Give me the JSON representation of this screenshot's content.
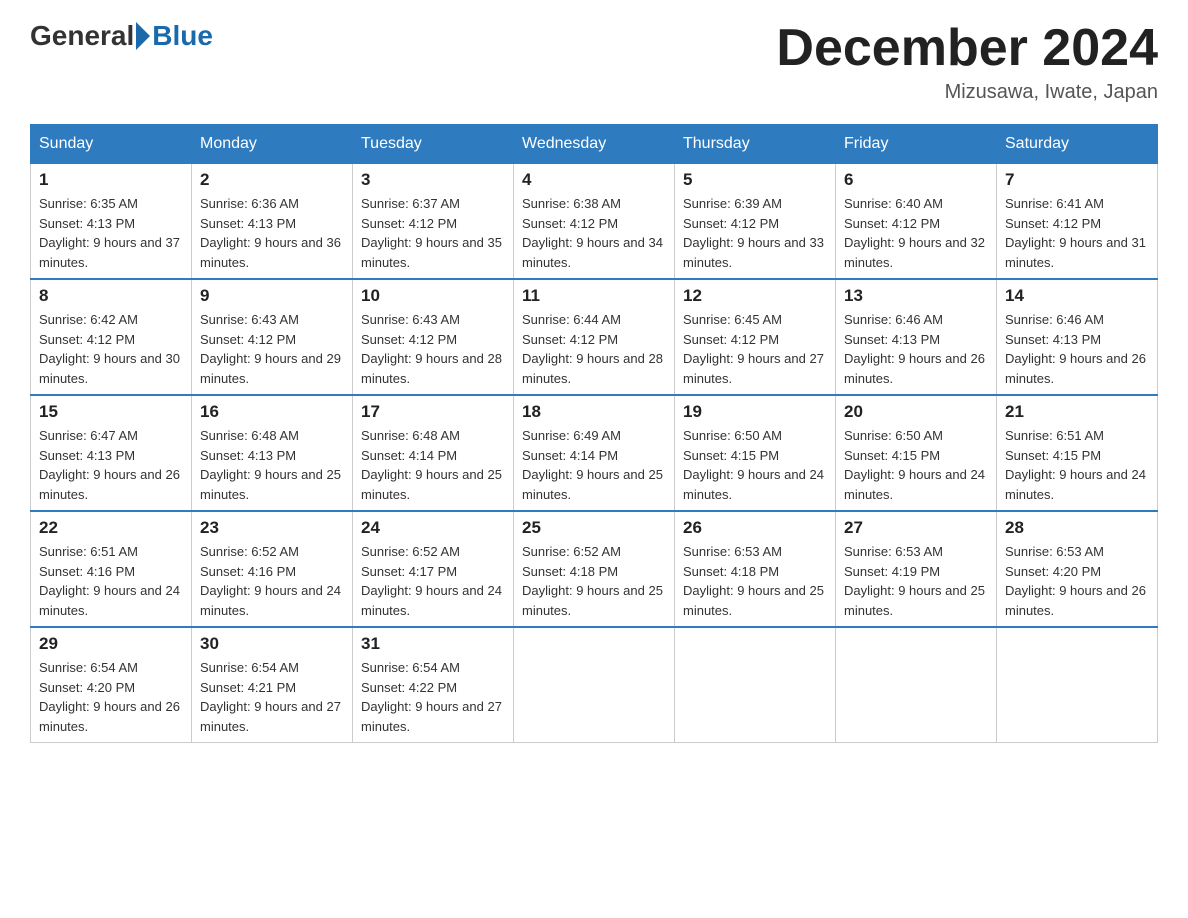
{
  "header": {
    "logo_general": "General",
    "logo_blue": "Blue",
    "title": "December 2024",
    "location": "Mizusawa, Iwate, Japan"
  },
  "weekdays": [
    "Sunday",
    "Monday",
    "Tuesday",
    "Wednesday",
    "Thursday",
    "Friday",
    "Saturday"
  ],
  "weeks": [
    [
      {
        "day": "1",
        "sunrise": "Sunrise: 6:35 AM",
        "sunset": "Sunset: 4:13 PM",
        "daylight": "Daylight: 9 hours and 37 minutes."
      },
      {
        "day": "2",
        "sunrise": "Sunrise: 6:36 AM",
        "sunset": "Sunset: 4:13 PM",
        "daylight": "Daylight: 9 hours and 36 minutes."
      },
      {
        "day": "3",
        "sunrise": "Sunrise: 6:37 AM",
        "sunset": "Sunset: 4:12 PM",
        "daylight": "Daylight: 9 hours and 35 minutes."
      },
      {
        "day": "4",
        "sunrise": "Sunrise: 6:38 AM",
        "sunset": "Sunset: 4:12 PM",
        "daylight": "Daylight: 9 hours and 34 minutes."
      },
      {
        "day": "5",
        "sunrise": "Sunrise: 6:39 AM",
        "sunset": "Sunset: 4:12 PM",
        "daylight": "Daylight: 9 hours and 33 minutes."
      },
      {
        "day": "6",
        "sunrise": "Sunrise: 6:40 AM",
        "sunset": "Sunset: 4:12 PM",
        "daylight": "Daylight: 9 hours and 32 minutes."
      },
      {
        "day": "7",
        "sunrise": "Sunrise: 6:41 AM",
        "sunset": "Sunset: 4:12 PM",
        "daylight": "Daylight: 9 hours and 31 minutes."
      }
    ],
    [
      {
        "day": "8",
        "sunrise": "Sunrise: 6:42 AM",
        "sunset": "Sunset: 4:12 PM",
        "daylight": "Daylight: 9 hours and 30 minutes."
      },
      {
        "day": "9",
        "sunrise": "Sunrise: 6:43 AM",
        "sunset": "Sunset: 4:12 PM",
        "daylight": "Daylight: 9 hours and 29 minutes."
      },
      {
        "day": "10",
        "sunrise": "Sunrise: 6:43 AM",
        "sunset": "Sunset: 4:12 PM",
        "daylight": "Daylight: 9 hours and 28 minutes."
      },
      {
        "day": "11",
        "sunrise": "Sunrise: 6:44 AM",
        "sunset": "Sunset: 4:12 PM",
        "daylight": "Daylight: 9 hours and 28 minutes."
      },
      {
        "day": "12",
        "sunrise": "Sunrise: 6:45 AM",
        "sunset": "Sunset: 4:12 PM",
        "daylight": "Daylight: 9 hours and 27 minutes."
      },
      {
        "day": "13",
        "sunrise": "Sunrise: 6:46 AM",
        "sunset": "Sunset: 4:13 PM",
        "daylight": "Daylight: 9 hours and 26 minutes."
      },
      {
        "day": "14",
        "sunrise": "Sunrise: 6:46 AM",
        "sunset": "Sunset: 4:13 PM",
        "daylight": "Daylight: 9 hours and 26 minutes."
      }
    ],
    [
      {
        "day": "15",
        "sunrise": "Sunrise: 6:47 AM",
        "sunset": "Sunset: 4:13 PM",
        "daylight": "Daylight: 9 hours and 26 minutes."
      },
      {
        "day": "16",
        "sunrise": "Sunrise: 6:48 AM",
        "sunset": "Sunset: 4:13 PM",
        "daylight": "Daylight: 9 hours and 25 minutes."
      },
      {
        "day": "17",
        "sunrise": "Sunrise: 6:48 AM",
        "sunset": "Sunset: 4:14 PM",
        "daylight": "Daylight: 9 hours and 25 minutes."
      },
      {
        "day": "18",
        "sunrise": "Sunrise: 6:49 AM",
        "sunset": "Sunset: 4:14 PM",
        "daylight": "Daylight: 9 hours and 25 minutes."
      },
      {
        "day": "19",
        "sunrise": "Sunrise: 6:50 AM",
        "sunset": "Sunset: 4:15 PM",
        "daylight": "Daylight: 9 hours and 24 minutes."
      },
      {
        "day": "20",
        "sunrise": "Sunrise: 6:50 AM",
        "sunset": "Sunset: 4:15 PM",
        "daylight": "Daylight: 9 hours and 24 minutes."
      },
      {
        "day": "21",
        "sunrise": "Sunrise: 6:51 AM",
        "sunset": "Sunset: 4:15 PM",
        "daylight": "Daylight: 9 hours and 24 minutes."
      }
    ],
    [
      {
        "day": "22",
        "sunrise": "Sunrise: 6:51 AM",
        "sunset": "Sunset: 4:16 PM",
        "daylight": "Daylight: 9 hours and 24 minutes."
      },
      {
        "day": "23",
        "sunrise": "Sunrise: 6:52 AM",
        "sunset": "Sunset: 4:16 PM",
        "daylight": "Daylight: 9 hours and 24 minutes."
      },
      {
        "day": "24",
        "sunrise": "Sunrise: 6:52 AM",
        "sunset": "Sunset: 4:17 PM",
        "daylight": "Daylight: 9 hours and 24 minutes."
      },
      {
        "day": "25",
        "sunrise": "Sunrise: 6:52 AM",
        "sunset": "Sunset: 4:18 PM",
        "daylight": "Daylight: 9 hours and 25 minutes."
      },
      {
        "day": "26",
        "sunrise": "Sunrise: 6:53 AM",
        "sunset": "Sunset: 4:18 PM",
        "daylight": "Daylight: 9 hours and 25 minutes."
      },
      {
        "day": "27",
        "sunrise": "Sunrise: 6:53 AM",
        "sunset": "Sunset: 4:19 PM",
        "daylight": "Daylight: 9 hours and 25 minutes."
      },
      {
        "day": "28",
        "sunrise": "Sunrise: 6:53 AM",
        "sunset": "Sunset: 4:20 PM",
        "daylight": "Daylight: 9 hours and 26 minutes."
      }
    ],
    [
      {
        "day": "29",
        "sunrise": "Sunrise: 6:54 AM",
        "sunset": "Sunset: 4:20 PM",
        "daylight": "Daylight: 9 hours and 26 minutes."
      },
      {
        "day": "30",
        "sunrise": "Sunrise: 6:54 AM",
        "sunset": "Sunset: 4:21 PM",
        "daylight": "Daylight: 9 hours and 27 minutes."
      },
      {
        "day": "31",
        "sunrise": "Sunrise: 6:54 AM",
        "sunset": "Sunset: 4:22 PM",
        "daylight": "Daylight: 9 hours and 27 minutes."
      },
      null,
      null,
      null,
      null
    ]
  ]
}
